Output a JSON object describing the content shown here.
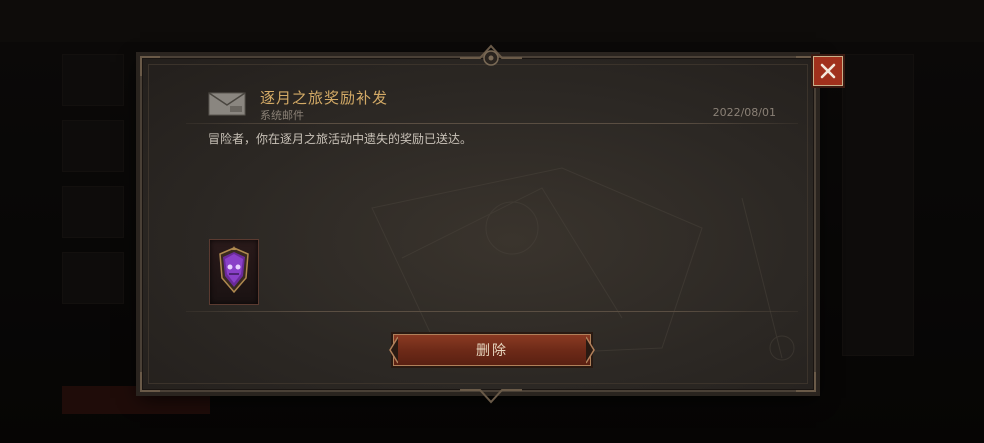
{
  "mail": {
    "title": "逐月之旅奖励补发",
    "sender": "系统邮件",
    "date": "2022/08/01",
    "body": "冒险者，你在逐月之旅活动中遗失的奖励已送达。"
  },
  "attachments": [
    {
      "icon": "purple-shield-emblem-icon"
    }
  ],
  "actions": {
    "delete_label": "删除"
  },
  "colors": {
    "title": "#d3aa66",
    "button": "#7a3020",
    "close": "#a0301c"
  }
}
